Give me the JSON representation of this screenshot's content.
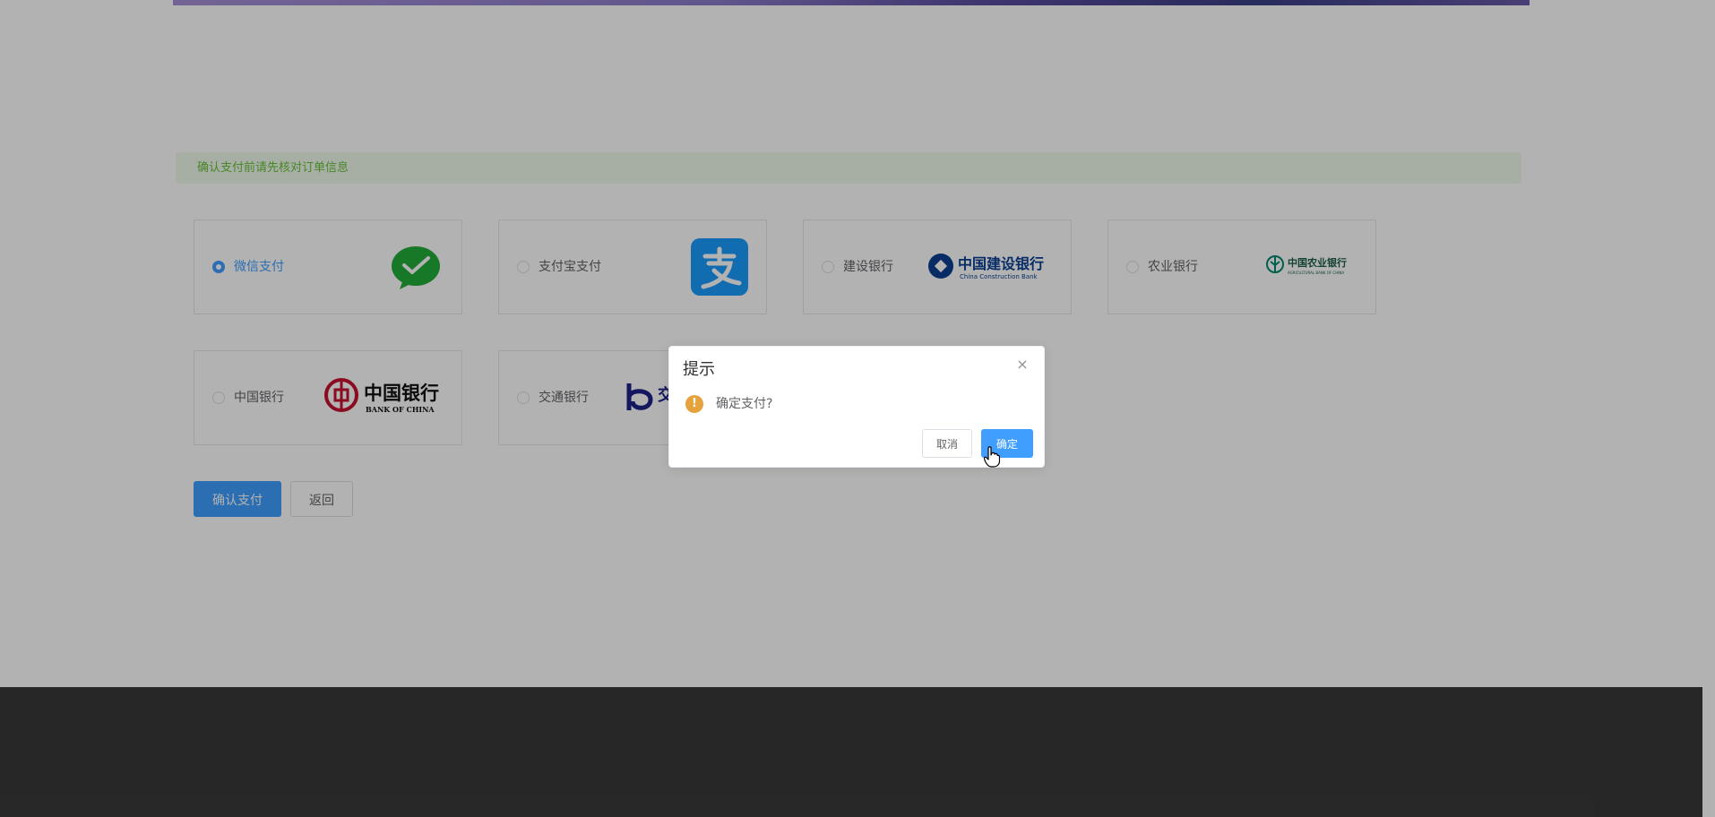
{
  "notice": "确认支付前请先核对订单信息",
  "payment_methods": [
    {
      "label": "微信支付",
      "selected": true,
      "logo": "wechat-pay-logo"
    },
    {
      "label": "支付宝支付",
      "selected": false,
      "logo": "alipay-logo"
    },
    {
      "label": "建设银行",
      "selected": false,
      "logo": "ccb-logo",
      "logo_text": "中国建设银行",
      "logo_subtext": "China Construction Bank"
    },
    {
      "label": "农业银行",
      "selected": false,
      "logo": "abc-logo",
      "logo_text": "中国农业银行",
      "logo_subtext": "AGRICULTURAL BANK OF CHINA"
    },
    {
      "label": "中国银行",
      "selected": false,
      "logo": "boc-logo",
      "logo_text": "中国银行",
      "logo_subtext": "BANK OF CHINA"
    },
    {
      "label": "交通银行",
      "selected": false,
      "logo": "bocom-logo",
      "logo_text": "交通银行"
    }
  ],
  "actions": {
    "confirm": "确认支付",
    "back": "返回"
  },
  "dialog": {
    "title": "提示",
    "message": "确定支付?",
    "cancel": "取消",
    "ok": "确定",
    "close_icon": "×",
    "warning_icon": "!"
  },
  "colors": {
    "primary": "#409eff",
    "success_text": "#67c23a",
    "warning": "#e6a23c",
    "footer": "#393939"
  }
}
